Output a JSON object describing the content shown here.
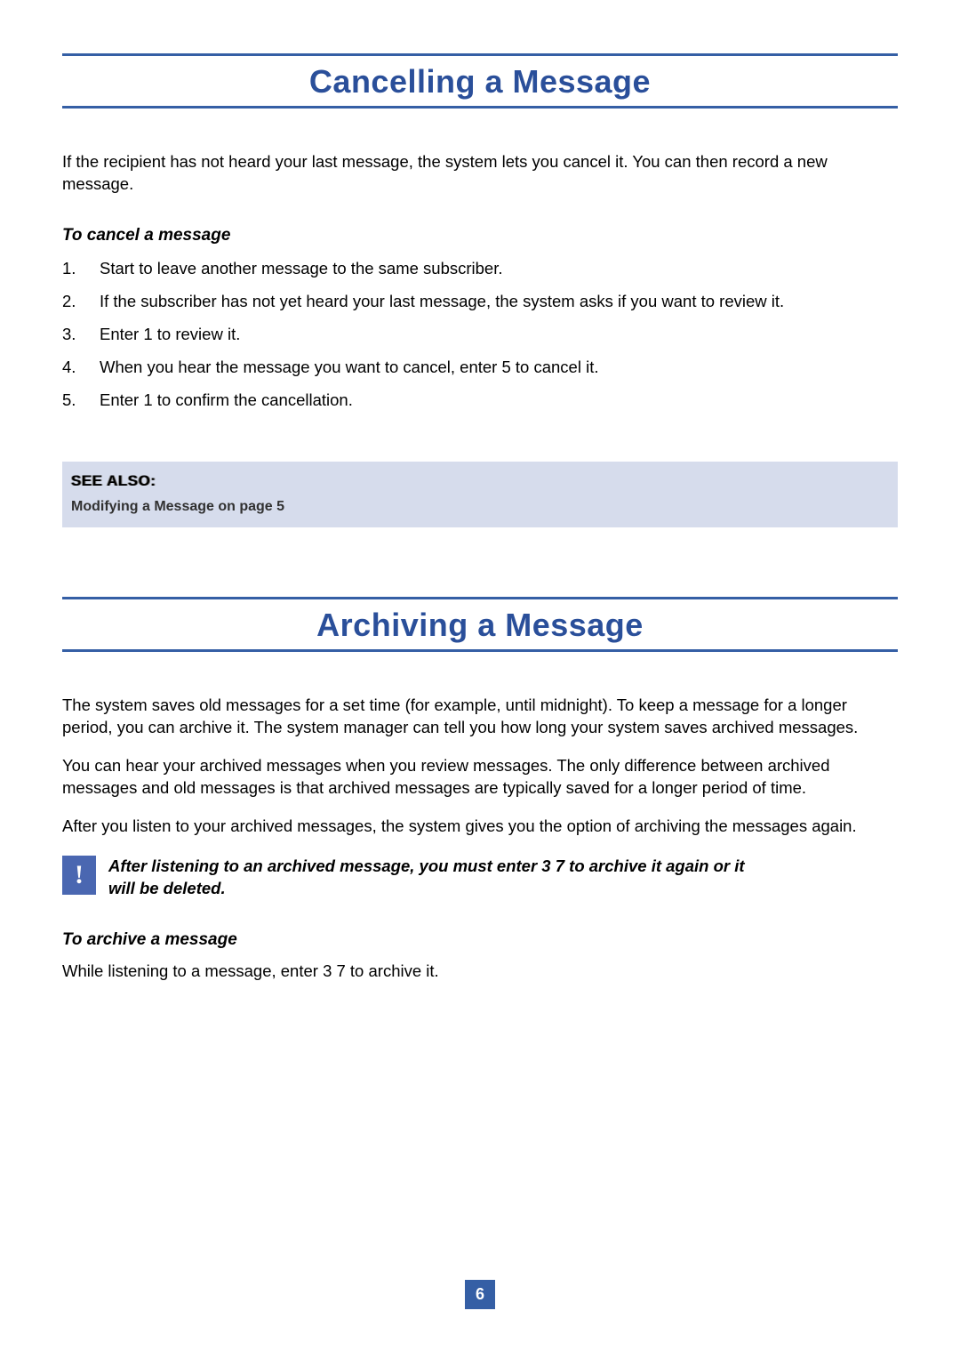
{
  "page_number": "6",
  "section1": {
    "title": "Cancelling a Message",
    "intro": "If the recipient has not heard your last message, the system lets you cancel it. You can then record a new message.",
    "sub": "To cancel a message",
    "steps": [
      "Start to leave another message to the same subscriber.",
      "If the subscriber has not yet heard your last message, the system asks if you want to review it.",
      "Enter 1 to review it.",
      "When you hear the message you want to cancel, enter 5 to cancel it.",
      "Enter 1 to confirm the cancellation."
    ]
  },
  "see_also": {
    "title": "SEE ALSO:",
    "item": "Modifying a Message on page 5"
  },
  "section2": {
    "title": "Archiving a Message",
    "p1": "The system saves old messages for a set time (for example, until midnight). To keep a message for a longer period, you can archive it. The system manager can tell you how long your system saves archived messages.",
    "p2": "You can hear your archived messages when you review messages. The only difference between archived messages and old messages is that archived messages are typically saved for a longer period of time.",
    "p3": "After you listen to your archived messages, the system gives you the option of archiving the messages again.",
    "alert": "After listening to an archived message, you must enter 3 7 to archive it again or it will be deleted.",
    "sub": "To archive a message",
    "p4": "While listening to a message, enter 3 7 to archive it."
  }
}
